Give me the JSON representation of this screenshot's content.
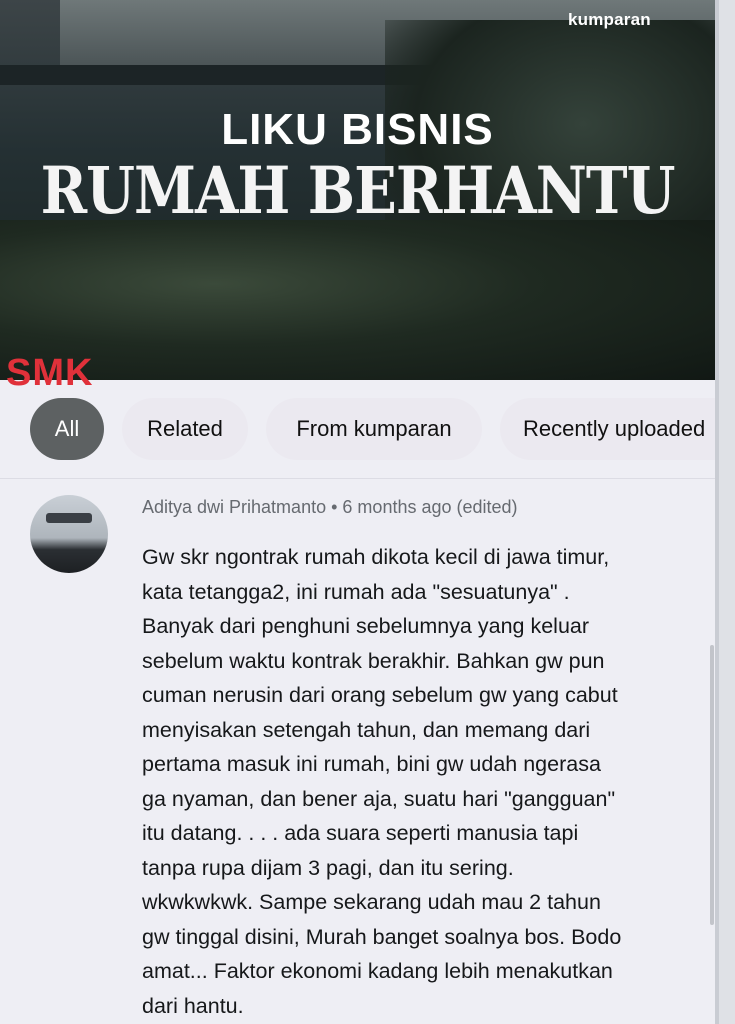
{
  "thumbnail": {
    "brand": "kumparan",
    "title_line1": "LIKU BISNIS",
    "title_line2": "RUMAH BERHANTU",
    "watermark": "SMK"
  },
  "filter_chips": [
    {
      "label": "All",
      "selected": true
    },
    {
      "label": "Related",
      "selected": false
    },
    {
      "label": "From kumparan",
      "selected": false
    },
    {
      "label": "Recently uploaded",
      "selected": false
    }
  ],
  "comment": {
    "author": "Aditya dwi Prihatmanto",
    "time": "6 months ago (edited)",
    "lines": [
      "Gw skr ngontrak rumah dikota kecil di jawa timur,",
      "kata tetangga2, ini rumah ada \"sesuatunya\" .",
      "Banyak dari penghuni sebelumnya yang keluar",
      "sebelum waktu kontrak berakhir. Bahkan gw pun",
      "cuman nerusin dari orang sebelum gw yang cabut",
      "menyisakan setengah tahun, dan memang dari",
      "pertama masuk ini rumah, bini gw udah ngerasa",
      "ga nyaman, dan bener aja, suatu hari \"gangguan\"",
      "itu datang. . . . ada suara seperti manusia tapi",
      "tanpa rupa dijam 3 pagi, dan itu sering.",
      "wkwkwkwk. Sampe sekarang udah mau 2 tahun",
      "gw tinggal disini, Murah banget soalnya bos.  Bodo",
      "amat... Faktor ekonomi kadang lebih menakutkan",
      "dari hantu."
    ]
  },
  "colors": {
    "selected_chip": "#5d6162",
    "chip": "#ebe9f0",
    "watermark": "#e0313a"
  }
}
